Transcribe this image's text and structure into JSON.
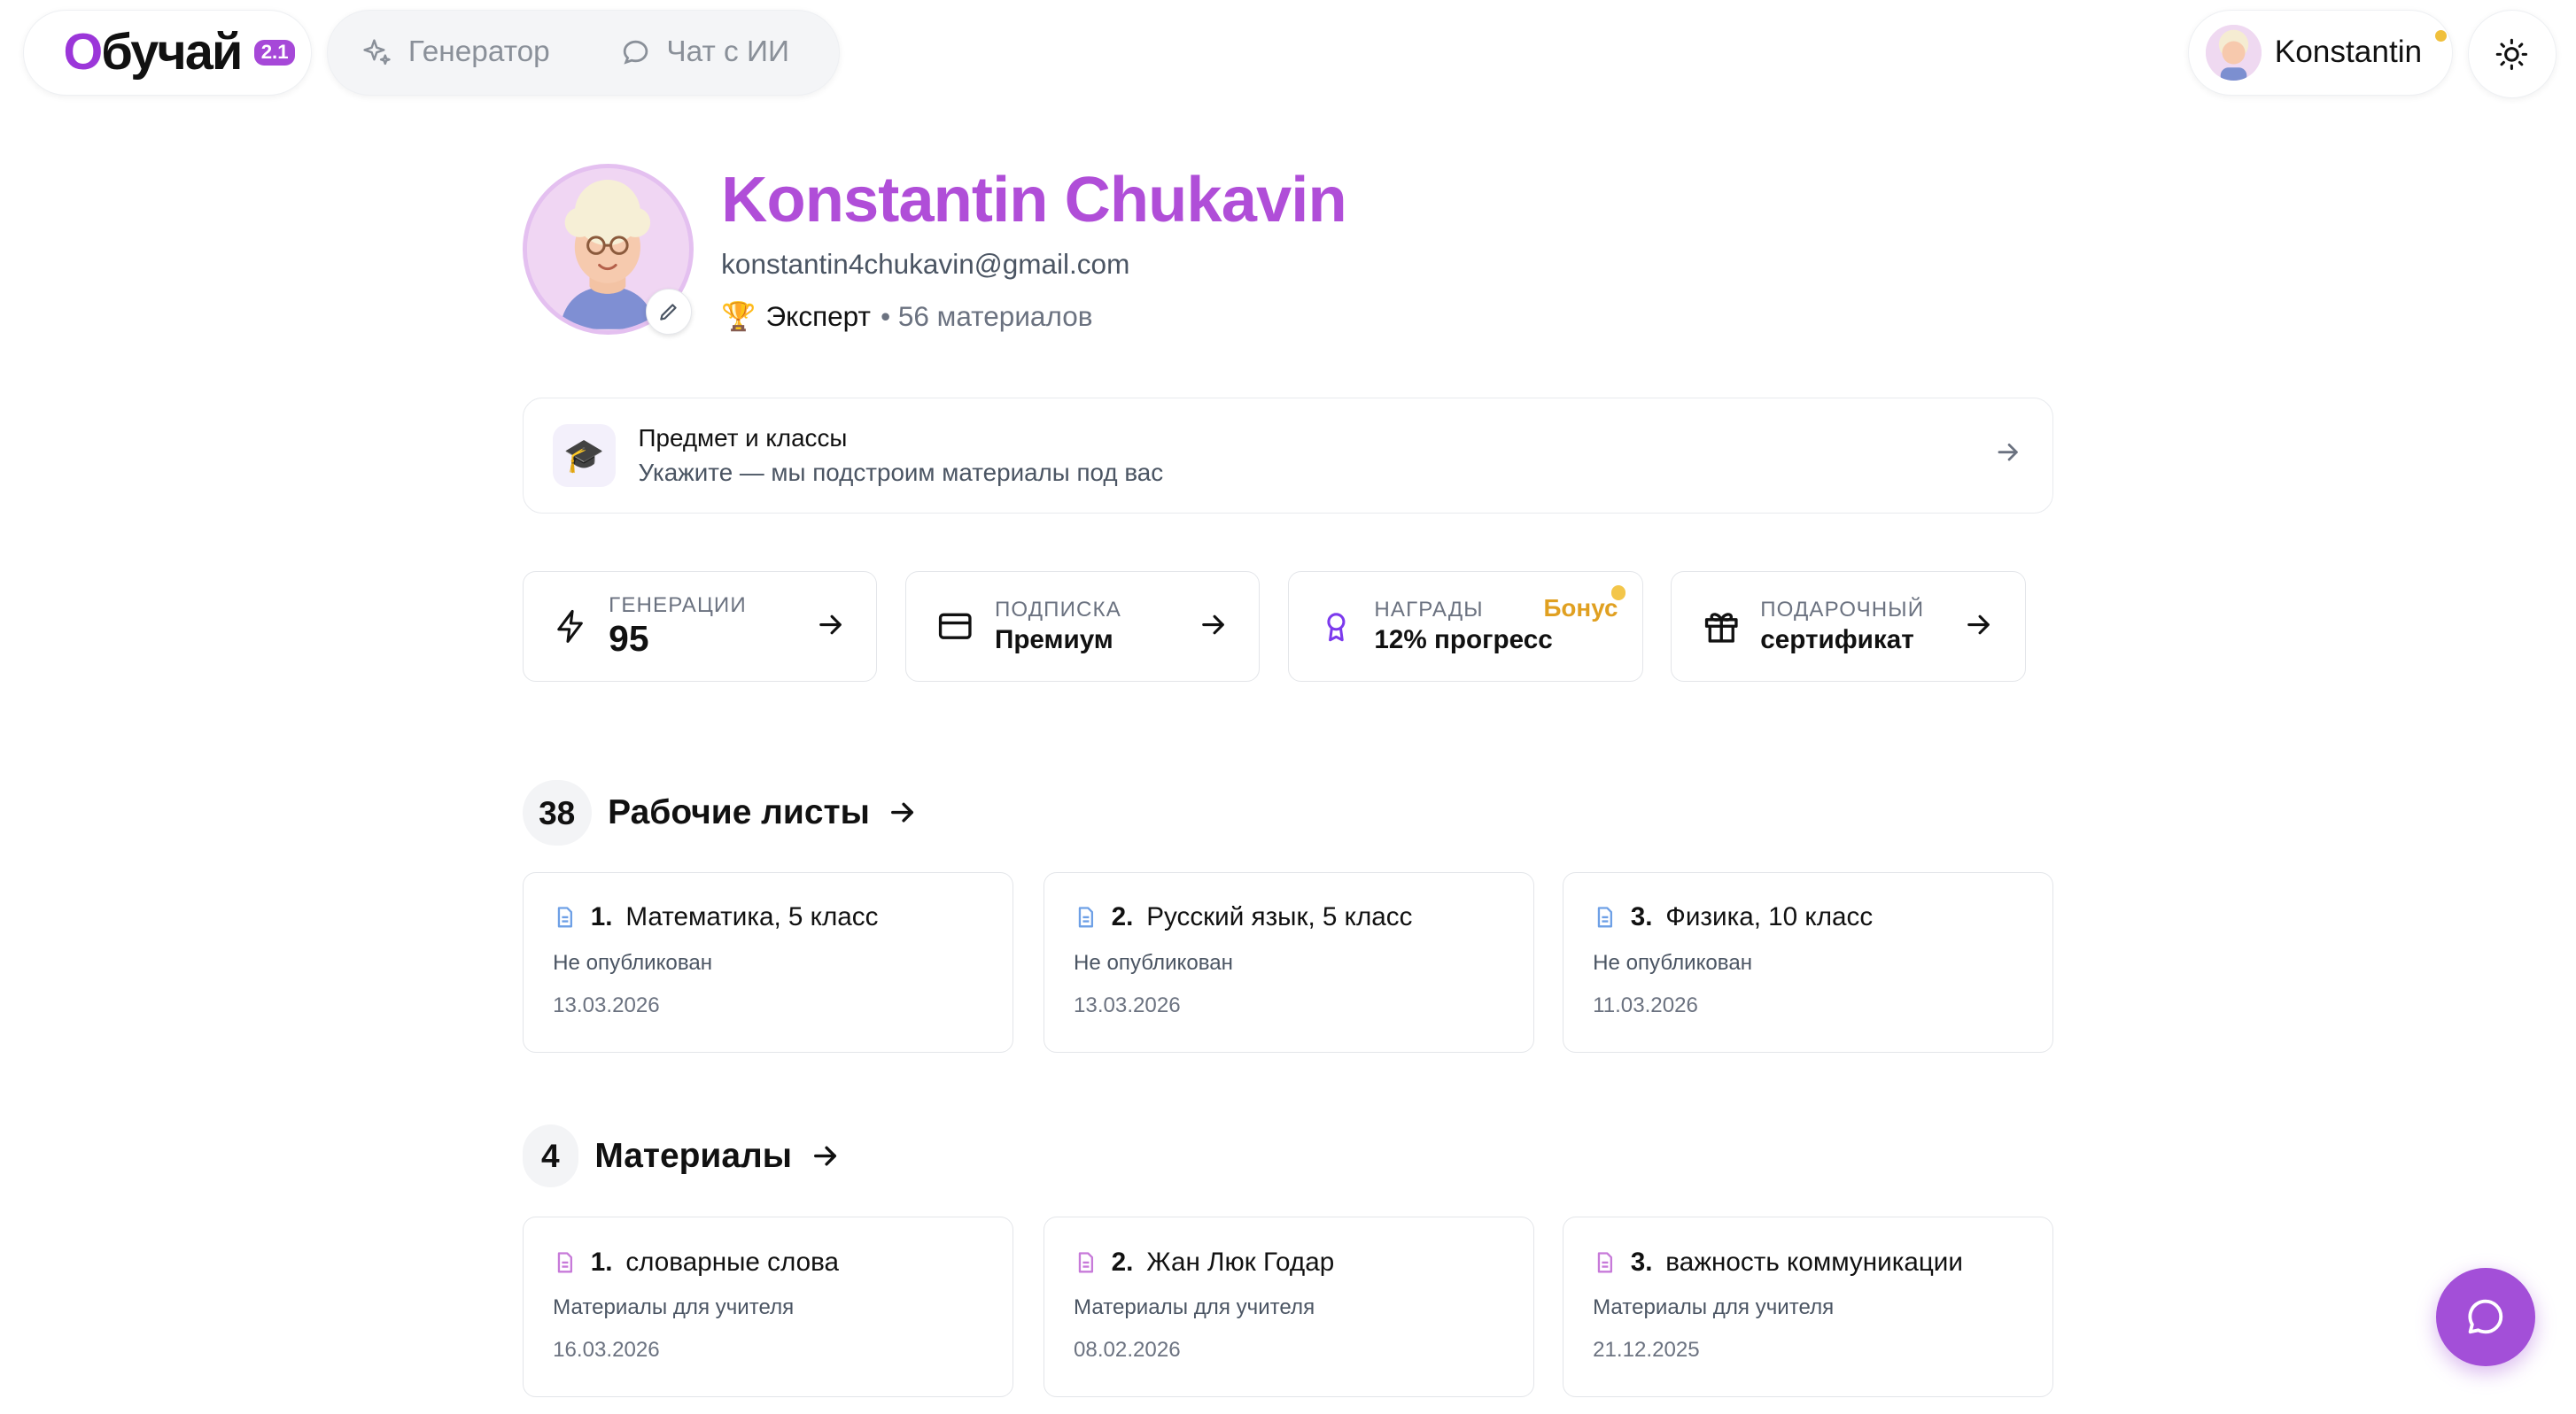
{
  "header": {
    "logo_text": "Обучай",
    "version_badge": "2.1",
    "nav": [
      {
        "label": "Генератор",
        "icon": "sparkle-icon"
      },
      {
        "label": "Чат с ИИ",
        "icon": "chat-bubble-icon"
      }
    ],
    "user_name": "Konstantin",
    "theme_icon": "sun-icon"
  },
  "profile": {
    "name": "Konstantin Chukavin",
    "email": "konstantin4chukavin@gmail.com",
    "rank_icon": "🏆",
    "rank": "Эксперт",
    "materials_count": "• 56 материалов"
  },
  "subject_card": {
    "icon": "🎓",
    "title": "Предмет и классы",
    "subtitle": "Укажите — мы подстроим материалы под вас"
  },
  "stats": [
    {
      "label": "ГЕНЕРАЦИИ",
      "value": "95",
      "icon": "lightning-icon"
    },
    {
      "label": "ПОДПИСКА",
      "value": "Премиум",
      "icon": "credit-card-icon"
    },
    {
      "label": "НАГРАДЫ",
      "value": "12% прогресс",
      "icon": "award-icon",
      "badge": "Бонус"
    },
    {
      "label": "ПОДАРОЧНЫЙ",
      "value": "сертификат",
      "icon": "gift-icon"
    }
  ],
  "worksheets": {
    "count": "38",
    "title": "Рабочие листы",
    "items": [
      {
        "num": "1.",
        "title": "Математика, 5 класс",
        "status": "Не опубликован",
        "date": "13.03.2026"
      },
      {
        "num": "2.",
        "title": "Русский язык, 5 класс",
        "status": "Не опубликован",
        "date": "13.03.2026"
      },
      {
        "num": "3.",
        "title": "Физика, 10 класс",
        "status": "Не опубликован",
        "date": "11.03.2026"
      }
    ]
  },
  "materials": {
    "count": "4",
    "title": "Материалы",
    "items": [
      {
        "num": "1.",
        "title": "словарные слова",
        "status": "Материалы для учителя",
        "date": "16.03.2026"
      },
      {
        "num": "2.",
        "title": "Жан Люк Годар",
        "status": "Материалы для учителя",
        "date": "08.02.2026"
      },
      {
        "num": "3.",
        "title": "важность коммуникации",
        "status": "Материалы для учителя",
        "date": "21.12.2025"
      }
    ]
  },
  "colors": {
    "accent": "#a648d8",
    "name": "#b04ed8",
    "bonus": "#e0a021",
    "worksheet_icon": "#6ea0e6",
    "material_icon": "#c77ad9"
  }
}
